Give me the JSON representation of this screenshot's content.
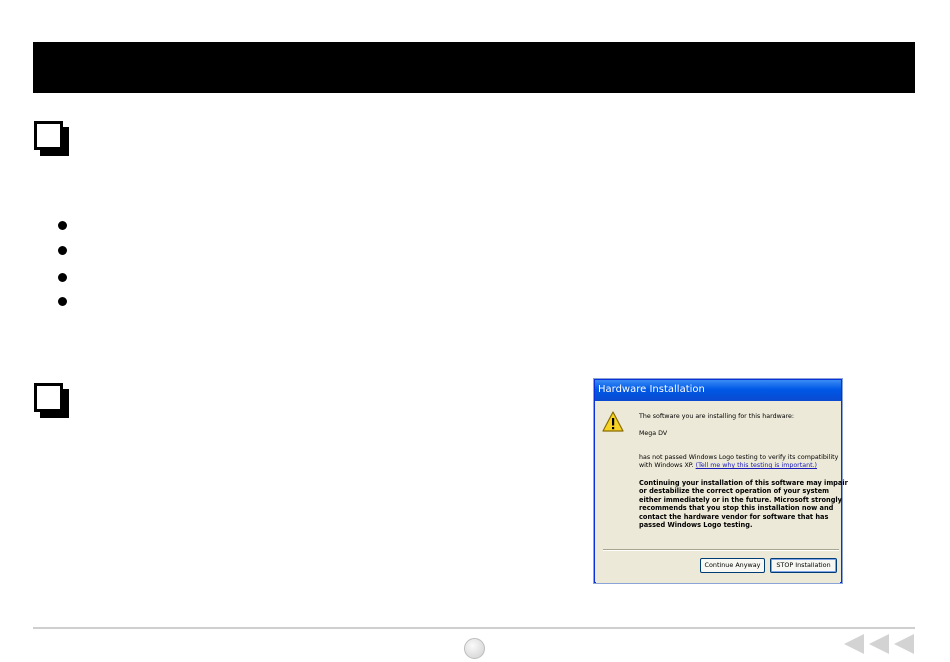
{
  "dialog": {
    "title": "Hardware Installation",
    "line1": "The software you are installing for this hardware:",
    "device": "Mega DV",
    "line2a": "has not passed Windows Logo testing to verify its compatibility",
    "line2b_prefix": "with Windows XP. ",
    "link": "(Tell me why this testing is important.)",
    "warning_lines": [
      "Continuing your installation of this software may impair",
      "or destabilize the correct operation of your system",
      "either immediately or in the future. Microsoft strongly",
      "recommends that you stop this installation now and",
      "contact the hardware vendor for software that has",
      "passed Windows Logo testing."
    ],
    "continue_label": "Continue Anyway",
    "stop_label": "STOP Installation"
  },
  "colors": {
    "header_bar": "#000000",
    "title_bar": "#0058e6",
    "dialog_bg": "#ece9d8"
  },
  "icons": [
    "section-square-icon",
    "bullet-dot-icon",
    "warning-icon",
    "page-indicator-icon",
    "back-arrows-icon"
  ]
}
